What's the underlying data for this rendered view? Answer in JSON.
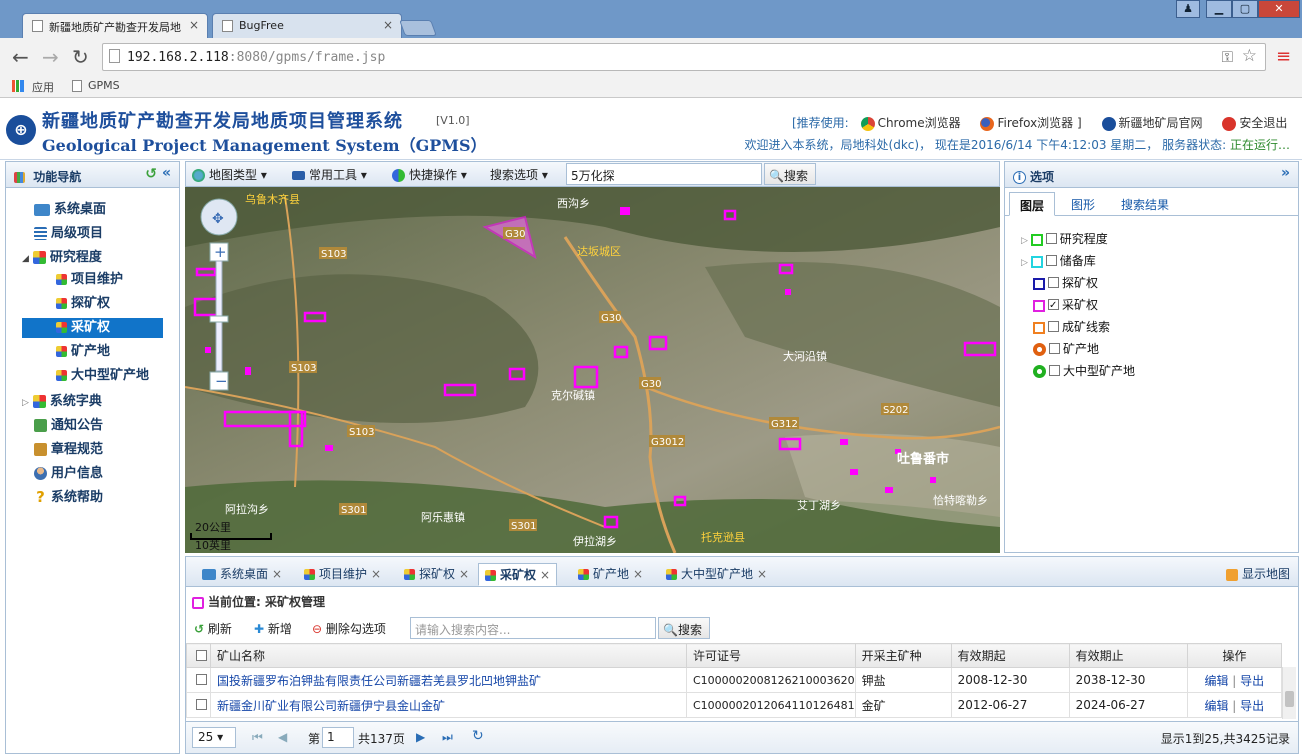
{
  "browser": {
    "tabs": [
      {
        "title": "新疆地质矿产勘查开发局地",
        "active": true
      },
      {
        "title": "BugFree",
        "active": false
      }
    ],
    "url_host": "192.168.2.118",
    "url_path": ":8080/gpms/frame.jsp",
    "bookmarks": [
      {
        "label": "应用"
      },
      {
        "label": "GPMS"
      }
    ]
  },
  "header": {
    "title_cn": "新疆地质矿产勘查开发局地质项目管理系统",
    "version": "[V1.0]",
    "title_en": "Geological Project Management System（GPMS）",
    "recommend_label": "[推荐使用:",
    "chrome_label": "Chrome浏览器",
    "firefox_label": "Firefox浏览器 ]",
    "official_site": "新疆地矿局官网",
    "logout": "安全退出",
    "status_text": "欢迎进入本系统，局地科处(dkc)， 现在是2016/6/14 下午4:12:03 星期二， 服务器状态: ",
    "status_ok": "正在运行…"
  },
  "leftnav": {
    "title": "功能导航",
    "items": [
      {
        "label": "系统桌面"
      },
      {
        "label": "局级项目"
      },
      {
        "label": "研究程度"
      },
      {
        "label": "项目维护"
      },
      {
        "label": "探矿权"
      },
      {
        "label": "采矿权"
      },
      {
        "label": "矿产地"
      },
      {
        "label": "大中型矿产地"
      },
      {
        "label": "系统字典"
      },
      {
        "label": "通知公告"
      },
      {
        "label": "章程规范"
      },
      {
        "label": "用户信息"
      },
      {
        "label": "系统帮助"
      }
    ]
  },
  "mapbar": {
    "map_type": "地图类型",
    "tools": "常用工具",
    "quick_ops": "快捷操作",
    "search_opts": "搜索选项",
    "search_value": "5万化探",
    "search_btn": "搜索"
  },
  "map": {
    "labels": [
      "乌鲁木齐县",
      "西沟乡",
      "达坂城区",
      "大河沿镇",
      "吐鲁番市",
      "艾丁湖乡",
      "恰特喀勒乡",
      "托克逊县",
      "伊拉湖乡",
      "阿拉沟乡",
      "阿乐惠镇",
      "克尔碱镇"
    ],
    "roads": [
      "G30",
      "G30",
      "G30",
      "S103",
      "S103",
      "S103",
      "S202",
      "G312",
      "G3012",
      "S301",
      "S301"
    ],
    "scale_km": "20公里",
    "scale_mi": "10英里"
  },
  "rightpanel": {
    "title": "选项",
    "tabs": [
      "图层",
      "图形",
      "搜索结果"
    ],
    "layers": [
      {
        "label": "研究程度",
        "checked": false,
        "color": "#22cc22"
      },
      {
        "label": "储备库",
        "checked": false,
        "color": "#22d4e0"
      },
      {
        "label": "探矿权",
        "checked": false,
        "color": "#1a1aaa"
      },
      {
        "label": "采矿权",
        "checked": true,
        "color": "#e020e0"
      },
      {
        "label": "成矿线索",
        "checked": false,
        "color": "#f08020"
      },
      {
        "label": "矿产地",
        "checked": false,
        "color": "#e06010"
      },
      {
        "label": "大中型矿产地",
        "checked": false,
        "color": "#20b020"
      }
    ]
  },
  "bottom": {
    "tabs": [
      "系统桌面",
      "项目维护",
      "探矿权",
      "采矿权",
      "矿产地",
      "大中型矿产地"
    ],
    "show_map": "显示地图",
    "crumb": "当前位置: 采矿权管理",
    "refresh": "刷新",
    "add": "新增",
    "delete": "删除勾选项",
    "search_placeholder": "请输入搜索内容...",
    "search_btn": "搜索",
    "columns": [
      "矿山名称",
      "许可证号",
      "开采主矿种",
      "有效期起",
      "有效期止",
      "操作"
    ],
    "rows": [
      {
        "name": "国投新疆罗布泊钾盐有限责任公司新疆若羌县罗北凹地钾盐矿",
        "license": "C1000002008126210003620",
        "mineral": "钾盐",
        "start": "2008-12-30",
        "end": "2038-12-30"
      },
      {
        "name": "新疆金川矿业有限公司新疆伊宁县金山金矿",
        "license": "C1000002012064110126481",
        "mineral": "金矿",
        "start": "2012-06-27",
        "end": "2024-06-27"
      }
    ],
    "edit": "编辑",
    "export": "导出",
    "page_size": "25",
    "page_prefix": "第",
    "page_num": "1",
    "page_total": "共137页",
    "summary": "显示1到25,共3425记录"
  }
}
